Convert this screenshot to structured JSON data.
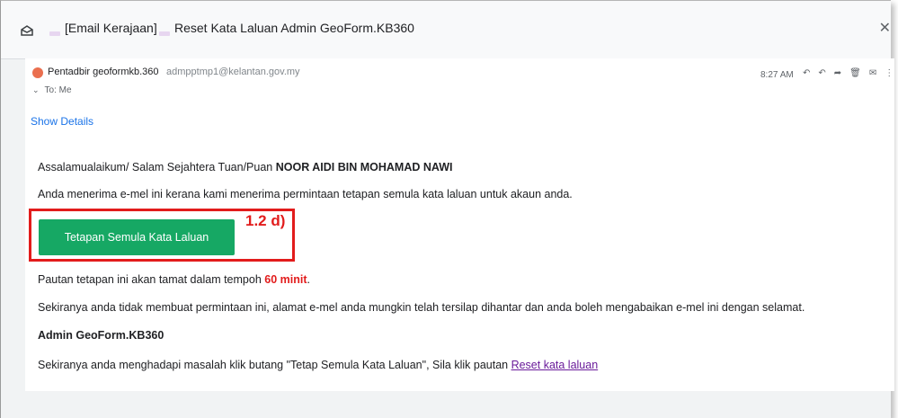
{
  "titlebar": {
    "prefix": "[Email Kerajaan]",
    "subject": "Reset Kata Laluan Admin GeoForm.KB360",
    "close_icon": "close-icon"
  },
  "message": {
    "sender_name": "Pentadbir geoformkb.360",
    "sender_email": "admpptmp1@kelantan.gov.my",
    "time": "8:27 AM",
    "to_line": "To: Me",
    "show_details": "Show Details",
    "actions": [
      "reply-icon",
      "reply-all-icon",
      "forward-icon",
      "delete-icon",
      "mail-icon",
      "more-icon"
    ]
  },
  "body": {
    "greeting_prefix": "Assalamualaikum/ Salam Sejahtera Tuan/Puan ",
    "greeting_name": "NOOR AIDI BIN MOHAMAD NAWI",
    "notice": "Anda menerima e-mel ini kerana kami menerima permintaan tetapan semula kata laluan untuk akaun anda.",
    "button_label": "Tetapan Semula Kata Laluan",
    "annotation": "1.2 d)",
    "expiry_prefix": "Pautan tetapan ini akan tamat dalam tempoh ",
    "expiry_value": "60 minit",
    "expiry_suffix": ".",
    "ignore_note": "Sekiranya anda tidak membuat permintaan ini, alamat e-mel anda mungkin telah tersilap dihantar dan anda boleh mengabaikan e-mel ini dengan selamat.",
    "signature": "Admin GeoForm.KB360",
    "trouble_prefix": "Sekiranya anda menghadapi masalah klik butang \"Tetap Semula Kata Laluan\", Sila klik pautan ",
    "trouble_link": "Reset kata laluan"
  },
  "colors": {
    "button": "#16a864",
    "annotation": "#e21c1c",
    "link": "#1a73e8",
    "visited_link": "#6a1b9a"
  }
}
